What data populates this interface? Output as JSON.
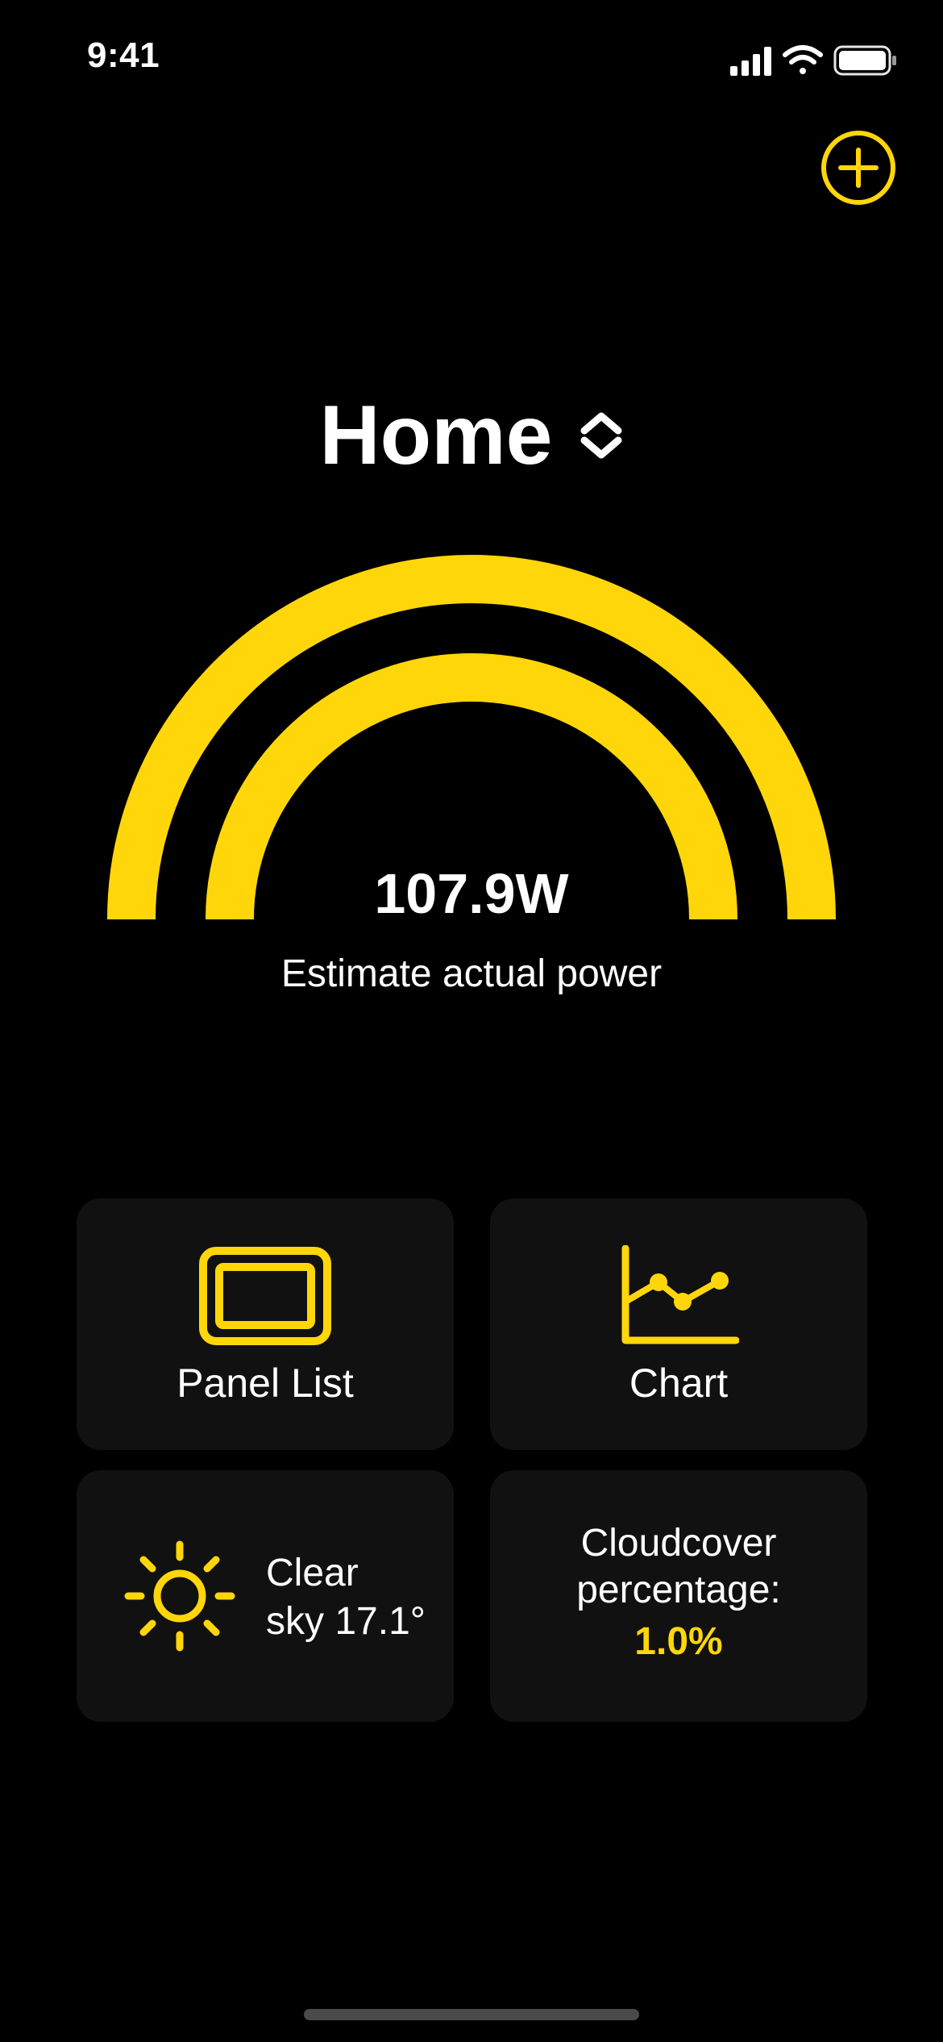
{
  "status_bar": {
    "time": "9:41"
  },
  "header": {
    "add_icon": "plus-circle-icon"
  },
  "location": {
    "name": "Home",
    "selector_icon": "chevron-up-down-icon"
  },
  "power": {
    "value": "107.9W",
    "label": "Estimate actual power"
  },
  "tiles": {
    "panel_list": {
      "label": "Panel List",
      "icon": "panel-icon"
    },
    "chart": {
      "label": "Chart",
      "icon": "line-chart-icon"
    },
    "weather": {
      "line1": "Clear",
      "line2": "sky 17.1°",
      "icon": "sun-icon"
    },
    "cloud": {
      "line1": "Cloudcover",
      "line2": "percentage:",
      "value": "1.0%"
    }
  },
  "colors": {
    "accent": "#ffd60a",
    "background": "#000000",
    "tile": "#111111",
    "text": "#ffffff"
  }
}
